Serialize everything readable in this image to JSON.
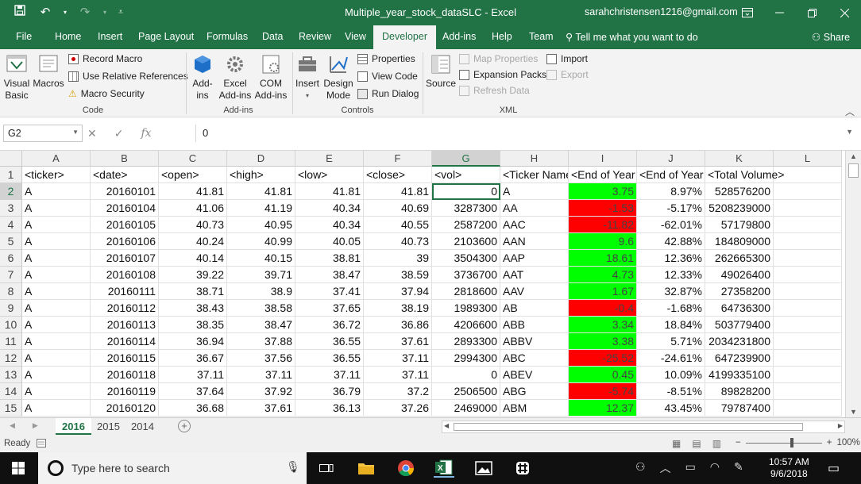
{
  "window": {
    "title": "Multiple_year_stock_dataSLC  -  Excel",
    "account": "sarahchristensen1216@gmail.com"
  },
  "ribbon": {
    "tabs": [
      "File",
      "Home",
      "Insert",
      "Page Layout",
      "Formulas",
      "Data",
      "Review",
      "View",
      "Developer",
      "Add-ins",
      "Help",
      "Team"
    ],
    "active_tab": "Developer",
    "tell_me": "Tell me what you want to do",
    "share": "Share",
    "code": {
      "label": "Code",
      "visual_basic": "Visual\nBasic",
      "macros": "Macros",
      "record_macro": "Record Macro",
      "relative_refs": "Use Relative References",
      "macro_security": "Macro Security"
    },
    "addins": {
      "label": "Add-ins",
      "addins_btn": "Add-\nins",
      "excel_addins": "Excel\nAdd-ins",
      "com_addins": "COM\nAdd-ins"
    },
    "controls": {
      "label": "Controls",
      "insert": "Insert",
      "design_mode": "Design\nMode",
      "properties": "Properties",
      "view_code": "View Code",
      "run_dialog": "Run Dialog"
    },
    "xml": {
      "label": "XML",
      "source": "Source",
      "map_properties": "Map Properties",
      "expansion_packs": "Expansion Packs",
      "refresh_data": "Refresh Data",
      "import": "Import",
      "export": "Export"
    }
  },
  "formula_bar": {
    "name_box": "G2",
    "fx": "fx",
    "value": "0"
  },
  "sheet": {
    "columns": [
      "A",
      "B",
      "C",
      "D",
      "E",
      "F",
      "G",
      "H",
      "I",
      "J",
      "K",
      "L"
    ],
    "selected_column": "G",
    "selected_row": "2",
    "header_row": [
      "<ticker>",
      "<date>",
      "<open>",
      "<high>",
      "<low>",
      "<close>",
      "<vol>",
      "<Ticker Name>",
      "<End of Year",
      "<End of Year",
      "<Total Volume>",
      ""
    ],
    "rows": [
      {
        "n": "2",
        "cells": [
          "A",
          "20160101",
          "41.81",
          "41.81",
          "41.81",
          "41.81",
          "0",
          "A",
          "3.75",
          "8.97%",
          "528576200"
        ],
        "fill": "green"
      },
      {
        "n": "3",
        "cells": [
          "A",
          "20160104",
          "41.06",
          "41.19",
          "40.34",
          "40.69",
          "3287300",
          "AA",
          "-1.53",
          "-5.17%",
          "5208239000"
        ],
        "fill": "red"
      },
      {
        "n": "4",
        "cells": [
          "A",
          "20160105",
          "40.73",
          "40.95",
          "40.34",
          "40.55",
          "2587200",
          "AAC",
          "-11.82",
          "-62.01%",
          "57179800"
        ],
        "fill": "red"
      },
      {
        "n": "5",
        "cells": [
          "A",
          "20160106",
          "40.24",
          "40.99",
          "40.05",
          "40.73",
          "2103600",
          "AAN",
          "9.6",
          "42.88%",
          "184809000"
        ],
        "fill": "green"
      },
      {
        "n": "6",
        "cells": [
          "A",
          "20160107",
          "40.14",
          "40.15",
          "38.81",
          "39",
          "3504300",
          "AAP",
          "18.61",
          "12.36%",
          "262665300"
        ],
        "fill": "green"
      },
      {
        "n": "7",
        "cells": [
          "A",
          "20160108",
          "39.22",
          "39.71",
          "38.47",
          "38.59",
          "3736700",
          "AAT",
          "4.73",
          "12.33%",
          "49026400"
        ],
        "fill": "green"
      },
      {
        "n": "8",
        "cells": [
          "A",
          "20160111",
          "38.71",
          "38.9",
          "37.41",
          "37.94",
          "2818600",
          "AAV",
          "1.67",
          "32.87%",
          "27358200"
        ],
        "fill": "green"
      },
      {
        "n": "9",
        "cells": [
          "A",
          "20160112",
          "38.43",
          "38.58",
          "37.65",
          "38.19",
          "1989300",
          "AB",
          "-0.4",
          "-1.68%",
          "64736300"
        ],
        "fill": "red"
      },
      {
        "n": "10",
        "cells": [
          "A",
          "20160113",
          "38.35",
          "38.47",
          "36.72",
          "36.86",
          "4206600",
          "ABB",
          "3.34",
          "18.84%",
          "503779400"
        ],
        "fill": "green"
      },
      {
        "n": "11",
        "cells": [
          "A",
          "20160114",
          "36.94",
          "37.88",
          "36.55",
          "37.61",
          "2893300",
          "ABBV",
          "3.38",
          "5.71%",
          "2034231800"
        ],
        "fill": "green"
      },
      {
        "n": "12",
        "cells": [
          "A",
          "20160115",
          "36.67",
          "37.56",
          "36.55",
          "37.11",
          "2994300",
          "ABC",
          "-25.52",
          "-24.61%",
          "647239900"
        ],
        "fill": "red"
      },
      {
        "n": "13",
        "cells": [
          "A",
          "20160118",
          "37.11",
          "37.11",
          "37.11",
          "37.11",
          "0",
          "ABEV",
          "0.45",
          "10.09%",
          "4199335100"
        ],
        "fill": "green"
      },
      {
        "n": "14",
        "cells": [
          "A",
          "20160119",
          "37.64",
          "37.92",
          "36.79",
          "37.2",
          "2506500",
          "ABG",
          "-5.74",
          "-8.51%",
          "89828200"
        ],
        "fill": "red"
      },
      {
        "n": "15",
        "cells": [
          "A",
          "20160120",
          "36.68",
          "37.61",
          "36.13",
          "37.26",
          "2469000",
          "ABM",
          "12.37",
          "43.45%",
          "79787400"
        ],
        "fill": "green"
      }
    ],
    "tabs": [
      "2016",
      "2015",
      "2014"
    ],
    "active_tab": "2016"
  },
  "status": {
    "ready": "Ready",
    "zoom": "100%"
  },
  "taskbar": {
    "search_placeholder": "Type here to search",
    "time": "10:57 AM",
    "date": "9/6/2018"
  },
  "colors": {
    "excel_green": "#217346",
    "cell_green": "#00ff00",
    "cell_red": "#ff0000"
  }
}
